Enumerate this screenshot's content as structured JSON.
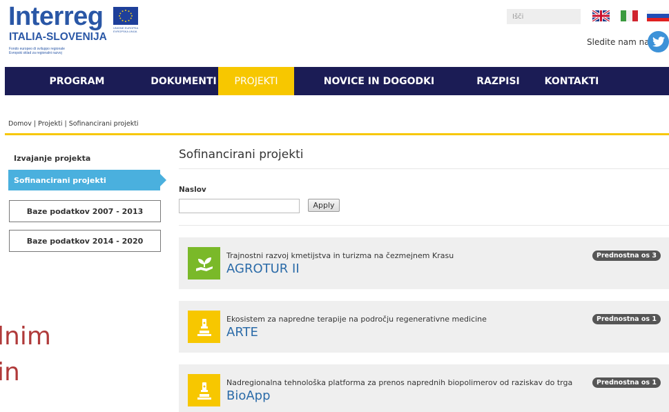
{
  "header": {
    "logo_title": "Interreg",
    "logo_sub": "ITALIA-SLOVENIJA",
    "logo_tag1": "Fondo europeo di sviluppo regionale",
    "logo_tag2": "Evropski sklad za regionalni razvoj",
    "eu_label_1": "UNIONE EUROPEA",
    "eu_label_2": "EVROPSKA UNIJA",
    "search_placeholder": "Išči",
    "follow_text": "Sledite nam na",
    "colors": {
      "brand_blue": "#2a57a6",
      "twitter": "#3d92d8"
    }
  },
  "nav": {
    "items": [
      {
        "label": "PROGRAM"
      },
      {
        "label": "DOKUMENTI"
      },
      {
        "label": "PROJEKTI"
      },
      {
        "label": "NOVICE IN DOGODKI"
      },
      {
        "label": "RAZPISI"
      },
      {
        "label": "KONTAKTI"
      }
    ],
    "active": "PROJEKTI",
    "colors": {
      "bar": "#1b1c55",
      "active": "#f7c700"
    }
  },
  "breadcrumb": "Domov | Projekti | Sofinancirani projekti",
  "sidebar": {
    "link": "Izvajanje projekta",
    "active": "Sofinancirani projekti",
    "buttons": [
      "Baze podatkov 2007 - 2013",
      "Baze podatkov 2014 - 2020"
    ]
  },
  "overflow_text": {
    "line1": "lnim",
    "line2": "in"
  },
  "main": {
    "title": "Sofinancirani projekti",
    "filter_label": "Naslov",
    "filter_value": "",
    "apply_label": "Apply",
    "projects": [
      {
        "subtitle": "Trajnostni razvoj kmetijstva in turizma na čezmejnem Krasu",
        "name": "AGROTUR II",
        "badge": "Prednostna os 3",
        "icon": "plant-hand-icon",
        "icon_color": "#7ab929"
      },
      {
        "subtitle": "Ekosistem za napredne terapije na področju regenerativne medicine",
        "name": "ARTE",
        "badge": "Prednostna os 1",
        "icon": "microscope-icon",
        "icon_color": "#f7c700"
      },
      {
        "subtitle": "Nadregionalna tehnološka platforma za prenos naprednih biopolimerov od raziskav do trga",
        "name": "BioApp",
        "badge": "Prednostna os 1",
        "icon": "microscope-icon",
        "icon_color": "#f7c700"
      }
    ]
  }
}
